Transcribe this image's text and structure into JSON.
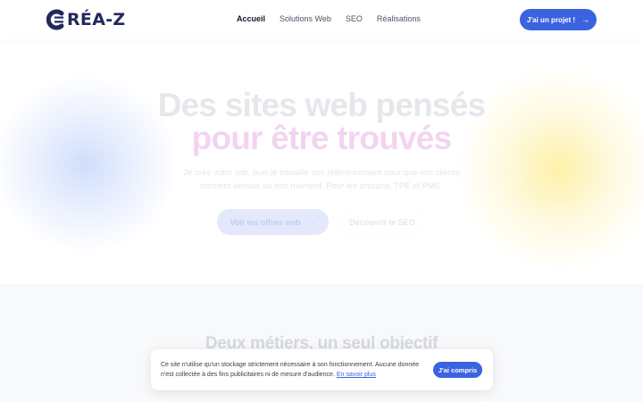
{
  "header": {
    "logo_text": "RÉA-Z",
    "nav": [
      {
        "label": "Accueil",
        "active": true
      },
      {
        "label": "Solutions Web",
        "active": false
      },
      {
        "label": "SEO",
        "active": false
      },
      {
        "label": "Réalisations",
        "active": false
      }
    ],
    "cta_label": "J'ai un projet !",
    "cta_icon": "arrow-right-icon"
  },
  "hero": {
    "title_line1": "Des sites web pensés",
    "title_line2": "pour être trouvés",
    "subtitle_line1": "Je crée votre site, puis je travaille son référencement pour que vos clients",
    "subtitle_line2": "tombent dessus au bon moment. Pour les artisans, TPE et PME.",
    "primary_button": "Voir les offres web",
    "secondary_button": "Découvrir le SEO"
  },
  "section2": {
    "title": "Deux métiers, un seul objectif"
  },
  "cookie": {
    "text_line1": "Ce site n'utilise qu'un stockage strictement nécessaire à son fonctionnement. Aucune donnée",
    "text_line2": "n'est collectée à des fins publicitaires ni de mesure d'audience.",
    "link": "En savoir plus",
    "accept_button": "J'ai compris"
  },
  "colors": {
    "brand_dark": "#23285c",
    "accent_blue": "#3b63e0",
    "title_accent_pink": "#f3d4f0"
  }
}
